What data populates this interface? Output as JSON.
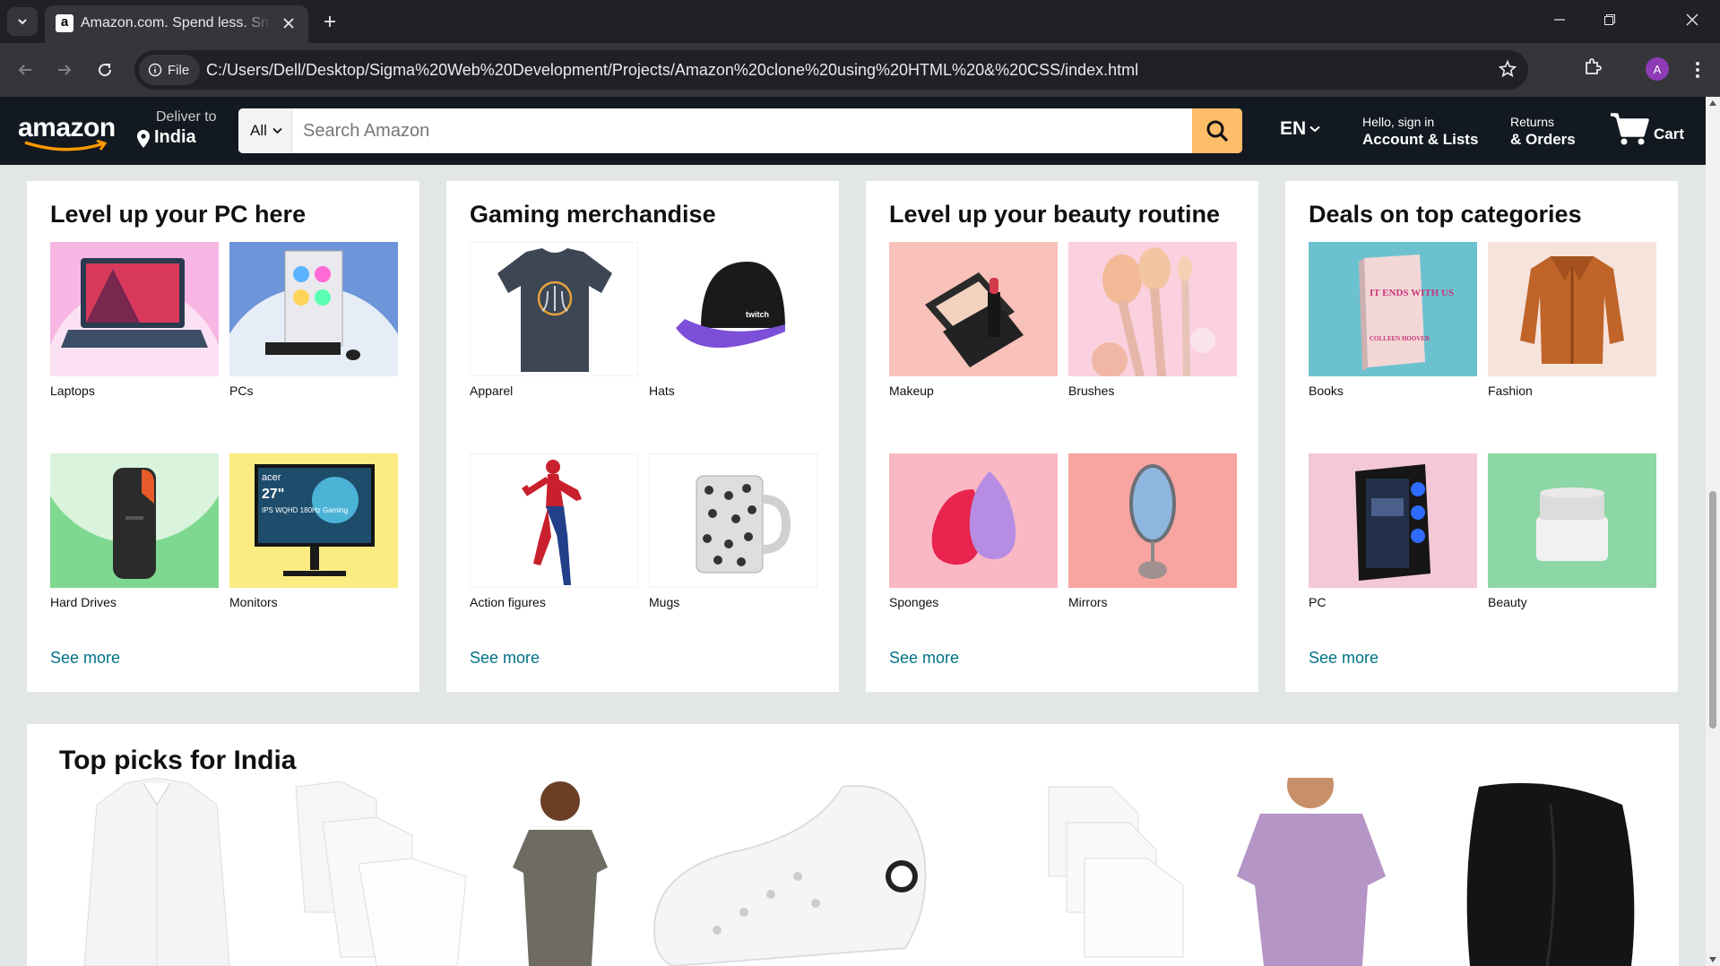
{
  "browser": {
    "tab_title": "Amazon.com. Spend less. Smile more.",
    "favicon": "a",
    "address_chip": "File",
    "url": "C:/Users/Dell/Desktop/Sigma%20Web%20Development/Projects/Amazon%20clone%20using%20HTML%20&%20CSS/index.html",
    "profile_initial": "A"
  },
  "nav": {
    "logo": "amazon",
    "deliver_top": "Deliver to",
    "deliver_bottom": "India",
    "search_category": "All",
    "search_placeholder": "Search Amazon",
    "language": "EN",
    "account_top": "Hello, sign in",
    "account_bottom": "Account & Lists",
    "orders_top": "Returns",
    "orders_bottom": "& Orders",
    "cart": "Cart"
  },
  "cards": [
    {
      "title": "Level up your PC here",
      "items": [
        {
          "label": "Laptops"
        },
        {
          "label": "PCs"
        },
        {
          "label": "Hard Drives"
        },
        {
          "label": "Monitors"
        }
      ],
      "see_more": "See more"
    },
    {
      "title": "Gaming merchandise",
      "items": [
        {
          "label": "Apparel"
        },
        {
          "label": "Hats"
        },
        {
          "label": "Action figures"
        },
        {
          "label": "Mugs"
        }
      ],
      "see_more": "See more"
    },
    {
      "title": "Level up your beauty routine",
      "items": [
        {
          "label": "Makeup"
        },
        {
          "label": "Brushes"
        },
        {
          "label": "Sponges"
        },
        {
          "label": "Mirrors"
        }
      ],
      "see_more": "See more"
    },
    {
      "title": "Deals on top categories",
      "items": [
        {
          "label": "Books"
        },
        {
          "label": "Fashion"
        },
        {
          "label": "PC"
        },
        {
          "label": "Beauty"
        }
      ],
      "see_more": "See more"
    }
  ],
  "image_text": {
    "monitor_brand": "acer",
    "monitor_size": "27\"",
    "monitor_desc": "IPS WQHD 180Hz Gaming",
    "hat_brand": "twitch",
    "book_title": "IT ENDS WITH US",
    "book_author": "COLLEEN HOOVER"
  },
  "top_picks": {
    "title": "Top picks for India"
  }
}
